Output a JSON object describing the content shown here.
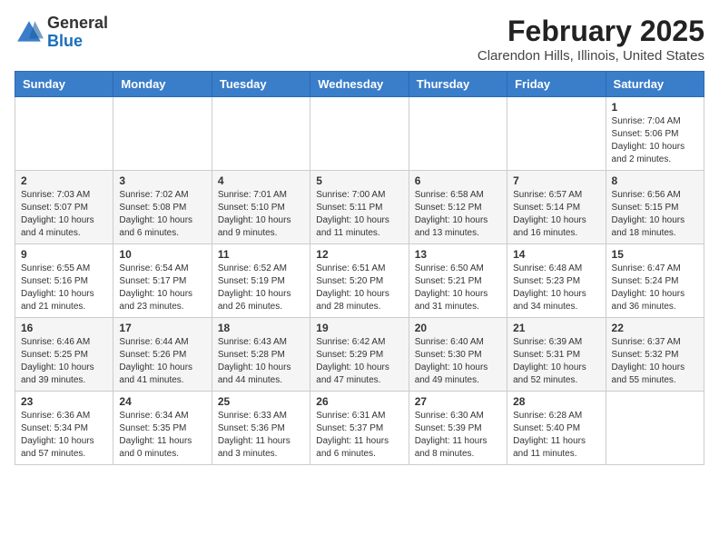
{
  "header": {
    "logo_general": "General",
    "logo_blue": "Blue",
    "month_year": "February 2025",
    "location": "Clarendon Hills, Illinois, United States"
  },
  "weekdays": [
    "Sunday",
    "Monday",
    "Tuesday",
    "Wednesday",
    "Thursday",
    "Friday",
    "Saturday"
  ],
  "weeks": [
    [
      {
        "day": "",
        "info": ""
      },
      {
        "day": "",
        "info": ""
      },
      {
        "day": "",
        "info": ""
      },
      {
        "day": "",
        "info": ""
      },
      {
        "day": "",
        "info": ""
      },
      {
        "day": "",
        "info": ""
      },
      {
        "day": "1",
        "info": "Sunrise: 7:04 AM\nSunset: 5:06 PM\nDaylight: 10 hours\nand 2 minutes."
      }
    ],
    [
      {
        "day": "2",
        "info": "Sunrise: 7:03 AM\nSunset: 5:07 PM\nDaylight: 10 hours\nand 4 minutes."
      },
      {
        "day": "3",
        "info": "Sunrise: 7:02 AM\nSunset: 5:08 PM\nDaylight: 10 hours\nand 6 minutes."
      },
      {
        "day": "4",
        "info": "Sunrise: 7:01 AM\nSunset: 5:10 PM\nDaylight: 10 hours\nand 9 minutes."
      },
      {
        "day": "5",
        "info": "Sunrise: 7:00 AM\nSunset: 5:11 PM\nDaylight: 10 hours\nand 11 minutes."
      },
      {
        "day": "6",
        "info": "Sunrise: 6:58 AM\nSunset: 5:12 PM\nDaylight: 10 hours\nand 13 minutes."
      },
      {
        "day": "7",
        "info": "Sunrise: 6:57 AM\nSunset: 5:14 PM\nDaylight: 10 hours\nand 16 minutes."
      },
      {
        "day": "8",
        "info": "Sunrise: 6:56 AM\nSunset: 5:15 PM\nDaylight: 10 hours\nand 18 minutes."
      }
    ],
    [
      {
        "day": "9",
        "info": "Sunrise: 6:55 AM\nSunset: 5:16 PM\nDaylight: 10 hours\nand 21 minutes."
      },
      {
        "day": "10",
        "info": "Sunrise: 6:54 AM\nSunset: 5:17 PM\nDaylight: 10 hours\nand 23 minutes."
      },
      {
        "day": "11",
        "info": "Sunrise: 6:52 AM\nSunset: 5:19 PM\nDaylight: 10 hours\nand 26 minutes."
      },
      {
        "day": "12",
        "info": "Sunrise: 6:51 AM\nSunset: 5:20 PM\nDaylight: 10 hours\nand 28 minutes."
      },
      {
        "day": "13",
        "info": "Sunrise: 6:50 AM\nSunset: 5:21 PM\nDaylight: 10 hours\nand 31 minutes."
      },
      {
        "day": "14",
        "info": "Sunrise: 6:48 AM\nSunset: 5:23 PM\nDaylight: 10 hours\nand 34 minutes."
      },
      {
        "day": "15",
        "info": "Sunrise: 6:47 AM\nSunset: 5:24 PM\nDaylight: 10 hours\nand 36 minutes."
      }
    ],
    [
      {
        "day": "16",
        "info": "Sunrise: 6:46 AM\nSunset: 5:25 PM\nDaylight: 10 hours\nand 39 minutes."
      },
      {
        "day": "17",
        "info": "Sunrise: 6:44 AM\nSunset: 5:26 PM\nDaylight: 10 hours\nand 41 minutes."
      },
      {
        "day": "18",
        "info": "Sunrise: 6:43 AM\nSunset: 5:28 PM\nDaylight: 10 hours\nand 44 minutes."
      },
      {
        "day": "19",
        "info": "Sunrise: 6:42 AM\nSunset: 5:29 PM\nDaylight: 10 hours\nand 47 minutes."
      },
      {
        "day": "20",
        "info": "Sunrise: 6:40 AM\nSunset: 5:30 PM\nDaylight: 10 hours\nand 49 minutes."
      },
      {
        "day": "21",
        "info": "Sunrise: 6:39 AM\nSunset: 5:31 PM\nDaylight: 10 hours\nand 52 minutes."
      },
      {
        "day": "22",
        "info": "Sunrise: 6:37 AM\nSunset: 5:32 PM\nDaylight: 10 hours\nand 55 minutes."
      }
    ],
    [
      {
        "day": "23",
        "info": "Sunrise: 6:36 AM\nSunset: 5:34 PM\nDaylight: 10 hours\nand 57 minutes."
      },
      {
        "day": "24",
        "info": "Sunrise: 6:34 AM\nSunset: 5:35 PM\nDaylight: 11 hours\nand 0 minutes."
      },
      {
        "day": "25",
        "info": "Sunrise: 6:33 AM\nSunset: 5:36 PM\nDaylight: 11 hours\nand 3 minutes."
      },
      {
        "day": "26",
        "info": "Sunrise: 6:31 AM\nSunset: 5:37 PM\nDaylight: 11 hours\nand 6 minutes."
      },
      {
        "day": "27",
        "info": "Sunrise: 6:30 AM\nSunset: 5:39 PM\nDaylight: 11 hours\nand 8 minutes."
      },
      {
        "day": "28",
        "info": "Sunrise: 6:28 AM\nSunset: 5:40 PM\nDaylight: 11 hours\nand 11 minutes."
      },
      {
        "day": "",
        "info": ""
      }
    ]
  ]
}
